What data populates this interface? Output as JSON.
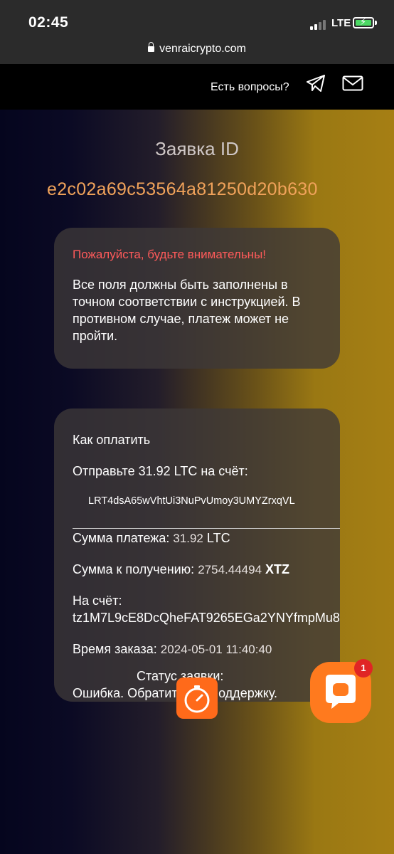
{
  "status_bar": {
    "time": "02:45",
    "network": "LTE",
    "battery_icon": "battery-charging-icon"
  },
  "browser": {
    "url": "venraicrypto.com"
  },
  "header": {
    "help_label": "Есть вопросы?",
    "telegram_icon": "telegram-icon",
    "mail_icon": "mail-icon"
  },
  "order": {
    "label": "Заявка ID",
    "id": "e2c02a69c53564a81250d20b630"
  },
  "warning": {
    "title": "Пожалуйста, будьте внимательны!",
    "text": "Все поля должны быть заполнены в точном соответствии с инструкцией. В противном случае, платеж может не пройти."
  },
  "payment": {
    "how_to_pay": "Как оплатить",
    "send_instruction": "Отправьте 31.92 LTC на счёт:",
    "deposit_address": "LRT4dsA65wVhtUi3NuPvUmoy3UMYZrxqVL",
    "amount_label": "Сумма платежа:",
    "amount_value": "31.92",
    "amount_currency": "LTC",
    "receive_label": "Сумма к получению:",
    "receive_value": "2754.44494",
    "receive_currency": "XTZ",
    "to_account_label": "На счёт:",
    "to_account_value": "tz1M7L9cE8DcQheFAT9265EGa2YNYfmpMu8",
    "order_time_label": "Время заказа:",
    "order_time_value": "2024-05-01 11:40:40",
    "status_label": "Статус заявки:",
    "status_value": "Ошибка. Обратитесь в поддержку."
  },
  "widgets": {
    "timer_icon": "stopwatch-icon",
    "chat_icon": "chat-bubble-icon",
    "chat_badge": "1"
  },
  "colors": {
    "accent_orange": "#ff6a1a",
    "order_id": "#f0a25a",
    "warning": "#ff5a5a"
  }
}
